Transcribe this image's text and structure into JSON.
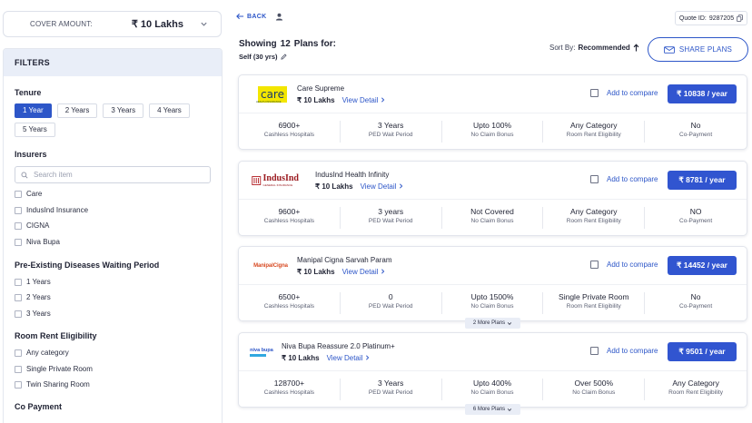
{
  "cover": {
    "label": "COVER AMOUNT:",
    "value": "₹ 10 Lakhs"
  },
  "filters": {
    "title": "FILTERS",
    "tenure": {
      "title": "Tenure",
      "options": [
        "1 Year",
        "2 Years",
        "3 Years",
        "4 Years",
        "5 Years"
      ],
      "selected": "1 Year"
    },
    "insurers": {
      "title": "Insurers",
      "search_placeholder": "Search item",
      "items": [
        "Care",
        "IndusInd Insurance",
        "CIGNA",
        "Niva Bupa"
      ]
    },
    "ped": {
      "title": "Pre-Existing Diseases Waiting Period",
      "items": [
        "1 Years",
        "2 Years",
        "3 Years"
      ]
    },
    "room_rent": {
      "title": "Room Rent Eligibility",
      "items": [
        "Any category",
        "Single Private Room",
        "Twin Sharing Room"
      ]
    },
    "copayment": {
      "title": "Co Payment"
    }
  },
  "header": {
    "back_label": "BACK",
    "quote_label": "Quote ID:",
    "quote_id": "9287205",
    "showing_prefix": "Showing",
    "plan_count": "12",
    "showing_suffix": "Plans for:",
    "self_label": "Self (30 yrs)",
    "sort_label": "Sort By:",
    "sort_value": "Recommended",
    "share_label": "SHARE PLANS"
  },
  "plans": [
    {
      "logo_text": "care",
      "logo_sub": "HEALTH INSURANCE",
      "name": "Care Supreme",
      "cover": "₹ 10 Lakhs",
      "view_detail": "View Detail",
      "compare_label": "Add to compare",
      "price": "₹ 10838 / year",
      "stats": [
        {
          "value": "6900+",
          "label": "Cashless Hospitals"
        },
        {
          "value": "3 Years",
          "label": "PED Wait Period"
        },
        {
          "value": "Upto 100%",
          "label": "No Claim Bonus"
        },
        {
          "value": "Any Category",
          "label": "Room Rent Eligibility"
        },
        {
          "value": "No",
          "label": "Co-Payment"
        }
      ],
      "more": ""
    },
    {
      "logo_text": "IndusInd",
      "logo_sub": "GENERAL INSURANCE",
      "name": "IndusInd Health Infinity",
      "cover": "₹ 10 Lakhs",
      "view_detail": "View Detail",
      "compare_label": "Add to compare",
      "price": "₹ 8781 / year",
      "stats": [
        {
          "value": "9600+",
          "label": "Cashless Hospitals"
        },
        {
          "value": "3 years",
          "label": "PED Wait Period"
        },
        {
          "value": "Not Covered",
          "label": "No Claim Bonus"
        },
        {
          "value": "Any Category",
          "label": "Room Rent Eligibility"
        },
        {
          "value": "NO",
          "label": "Co-Payment"
        }
      ],
      "more": ""
    },
    {
      "logo_text": "ManipalCigna",
      "logo_sub": "",
      "name": "Manipal Cigna Sarvah Param",
      "cover": "₹ 10 Lakhs",
      "view_detail": "View Detail",
      "compare_label": "Add to compare",
      "price": "₹ 14452 / year",
      "stats": [
        {
          "value": "6500+",
          "label": "Cashless Hospitals"
        },
        {
          "value": "0",
          "label": "PED Wait Period"
        },
        {
          "value": "Upto 1500%",
          "label": "No Claim Bonus"
        },
        {
          "value": "Single Private Room",
          "label": "Room Rent Eligibility"
        },
        {
          "value": "No",
          "label": "Co-Payment"
        }
      ],
      "more": "2 More Plans"
    },
    {
      "logo_text": "niva bupa",
      "logo_sub": "",
      "name": "Niva Bupa Reassure 2.0 Platinum+",
      "cover": "₹ 10 Lakhs",
      "view_detail": "View Detail",
      "compare_label": "Add to compare",
      "price": "₹ 9501 / year",
      "stats": [
        {
          "value": "128700+",
          "label": "Cashless Hospitals"
        },
        {
          "value": "3 Years",
          "label": "PED Wait Period"
        },
        {
          "value": "Upto 400%",
          "label": "No Claim Bonus"
        },
        {
          "value": "Over 500%",
          "label": "No Claim Bonus"
        },
        {
          "value": "Any Category",
          "label": "Room Rent Eligibility"
        }
      ],
      "more": "6 More Plans"
    }
  ],
  "colors": {
    "primary": "#2d56c8",
    "price_bg": "#3155d0",
    "filter_head_bg": "#e9eef8"
  }
}
